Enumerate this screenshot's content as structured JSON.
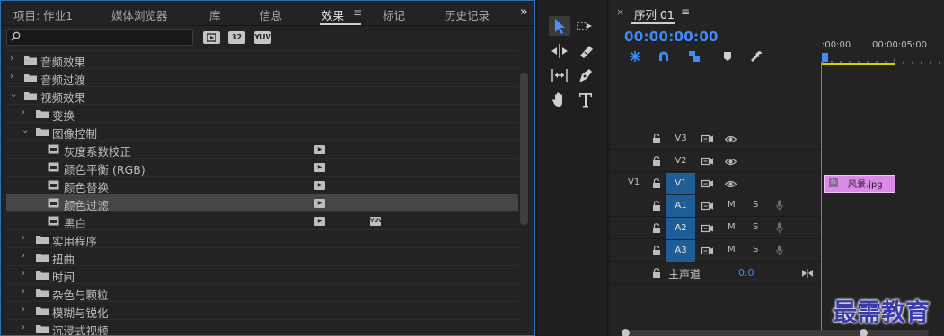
{
  "effects_panel": {
    "tabs": [
      {
        "label": "项目: 作业1"
      },
      {
        "label": "媒体浏览器"
      },
      {
        "label": "库"
      },
      {
        "label": "信息"
      },
      {
        "label": "效果",
        "active": true
      },
      {
        "label": "标记"
      },
      {
        "label": "历史记录"
      }
    ],
    "tab_menu_glyph": "≡",
    "overflow_glyph": "»",
    "search": {
      "value": "",
      "placeholder": ""
    },
    "filter_buttons": [
      "accelerated-effects-icon",
      "32",
      "YUV"
    ],
    "tree": [
      {
        "label": "音频效果",
        "type": "folder",
        "expanded": false,
        "depth": 0
      },
      {
        "label": "音频过渡",
        "type": "folder",
        "expanded": false,
        "depth": 0
      },
      {
        "label": "视频效果",
        "type": "folder",
        "expanded": true,
        "depth": 0
      },
      {
        "label": "变换",
        "type": "folder",
        "expanded": false,
        "depth": 1
      },
      {
        "label": "图像控制",
        "type": "folder",
        "expanded": true,
        "depth": 1
      },
      {
        "label": "灰度系数校正",
        "type": "effect",
        "depth": 2,
        "accelerated": true
      },
      {
        "label": "颜色平衡 (RGB)",
        "type": "effect",
        "depth": 2,
        "accelerated": true
      },
      {
        "label": "颜色替换",
        "type": "effect",
        "depth": 2,
        "accelerated": true
      },
      {
        "label": "颜色过滤",
        "type": "effect",
        "depth": 2,
        "accelerated": true,
        "selected": true
      },
      {
        "label": "黑白",
        "type": "effect",
        "depth": 2,
        "accelerated": true,
        "yuv": true
      },
      {
        "label": "实用程序",
        "type": "folder",
        "expanded": false,
        "depth": 1
      },
      {
        "label": "扭曲",
        "type": "folder",
        "expanded": false,
        "depth": 1
      },
      {
        "label": "时间",
        "type": "folder",
        "expanded": false,
        "depth": 1
      },
      {
        "label": "杂色与颗粒",
        "type": "folder",
        "expanded": false,
        "depth": 1
      },
      {
        "label": "模糊与锐化",
        "type": "folder",
        "expanded": false,
        "depth": 1
      },
      {
        "label": "沉浸式视频",
        "type": "folder",
        "expanded": false,
        "depth": 1
      }
    ]
  },
  "tools": [
    "selection-tool-icon",
    "track-select-tool-icon",
    "ripple-edit-tool-icon",
    "razor-tool-icon",
    "slip-tool-icon",
    "pen-tool-icon",
    "hand-tool-icon",
    "type-tool-icon"
  ],
  "timeline": {
    "close_glyph": "×",
    "sequence_title": "序列 01",
    "menu_glyph": "≡",
    "timecode": "00:00:00:00",
    "ruler": {
      "start": ":00:00",
      "mark": "00:00:05:00"
    },
    "tracks": [
      {
        "name": "V3",
        "kind": "video",
        "targeted": false,
        "source": ""
      },
      {
        "name": "V2",
        "kind": "video",
        "targeted": false,
        "source": ""
      },
      {
        "name": "V1",
        "kind": "video",
        "targeted": true,
        "source": "V1"
      },
      {
        "name": "A1",
        "kind": "audio",
        "targeted": true,
        "m": "M",
        "s": "S"
      },
      {
        "name": "A2",
        "kind": "audio",
        "targeted": true,
        "m": "M",
        "s": "S"
      },
      {
        "name": "A3",
        "kind": "audio",
        "targeted": true,
        "m": "M",
        "s": "S"
      }
    ],
    "master": {
      "label": "主声道",
      "value": "0.0"
    },
    "clip": {
      "name": "风景.jpg",
      "fx": "fx",
      "track": "V1",
      "color": "#d98be6"
    }
  },
  "watermark": "最需教育",
  "colors": {
    "accent": "#3d8bff",
    "panel_border": "#2f6fb8",
    "track_target": "#1e5d95",
    "work_area": "#d6d100"
  }
}
